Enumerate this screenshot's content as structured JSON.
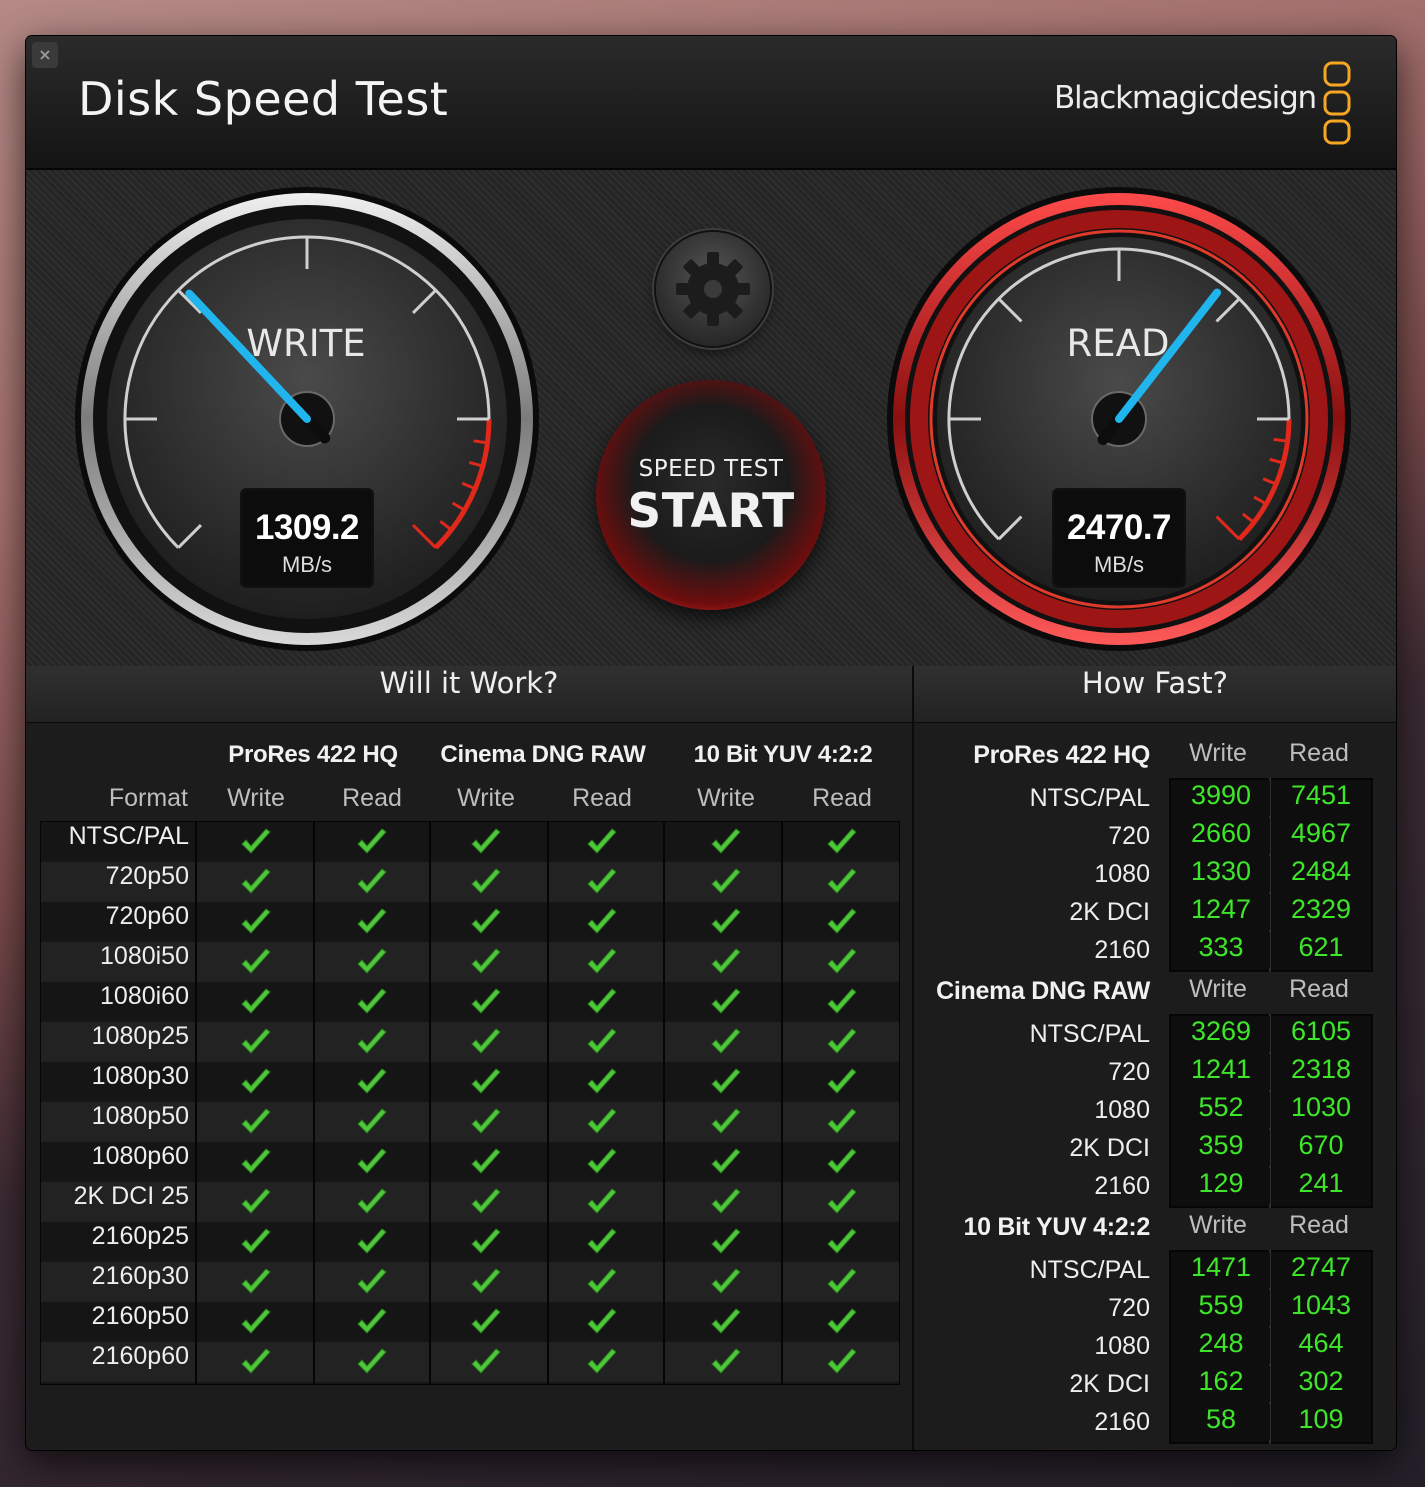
{
  "window": {
    "title": "Disk Speed Test",
    "close_glyph": "×",
    "brand": "Blackmagicdesign",
    "brand_color": "#f5a623"
  },
  "gauges": {
    "write": {
      "label": "WRITE",
      "value": "1309.2",
      "unit": "MB/s",
      "needle_fraction": 0.34
    },
    "read": {
      "label": "READ",
      "value": "2470.7",
      "unit": "MB/s",
      "needle_fraction": 0.64
    },
    "needle_color": "#21b5ee",
    "redline_color": "#e0291b"
  },
  "controls": {
    "settings_icon": "gear-icon",
    "start_top": "SPEED TEST",
    "start_main": "START"
  },
  "will_it_work": {
    "title": "Will it Work?",
    "format_header": "Format",
    "groups": [
      "ProRes 422 HQ",
      "Cinema DNG RAW",
      "10 Bit YUV 4:2:2"
    ],
    "subheaders": [
      "Write",
      "Read"
    ],
    "formats": [
      "NTSC/PAL",
      "720p50",
      "720p60",
      "1080i50",
      "1080i60",
      "1080p25",
      "1080p30",
      "1080p50",
      "1080p60",
      "2K DCI 25",
      "2160p25",
      "2160p30",
      "2160p50",
      "2160p60"
    ],
    "check_icon": "check-icon",
    "check_color": "#4ec73a"
  },
  "how_fast": {
    "title": "How Fast?",
    "write_label": "Write",
    "read_label": "Read",
    "sections": [
      {
        "name": "ProRes 422 HQ",
        "rows": [
          {
            "label": "NTSC/PAL",
            "write": "3990",
            "read": "7451"
          },
          {
            "label": "720",
            "write": "2660",
            "read": "4967"
          },
          {
            "label": "1080",
            "write": "1330",
            "read": "2484"
          },
          {
            "label": "2K DCI",
            "write": "1247",
            "read": "2329"
          },
          {
            "label": "2160",
            "write": "333",
            "read": "621"
          }
        ]
      },
      {
        "name": "Cinema DNG RAW",
        "rows": [
          {
            "label": "NTSC/PAL",
            "write": "3269",
            "read": "6105"
          },
          {
            "label": "720",
            "write": "1241",
            "read": "2318"
          },
          {
            "label": "1080",
            "write": "552",
            "read": "1030"
          },
          {
            "label": "2K DCI",
            "write": "359",
            "read": "670"
          },
          {
            "label": "2160",
            "write": "129",
            "read": "241"
          }
        ]
      },
      {
        "name": "10 Bit YUV 4:2:2",
        "rows": [
          {
            "label": "NTSC/PAL",
            "write": "1471",
            "read": "2747"
          },
          {
            "label": "720",
            "write": "559",
            "read": "1043"
          },
          {
            "label": "1080",
            "write": "248",
            "read": "464"
          },
          {
            "label": "2K DCI",
            "write": "162",
            "read": "302"
          },
          {
            "label": "2160",
            "write": "58",
            "read": "109"
          }
        ]
      }
    ]
  }
}
